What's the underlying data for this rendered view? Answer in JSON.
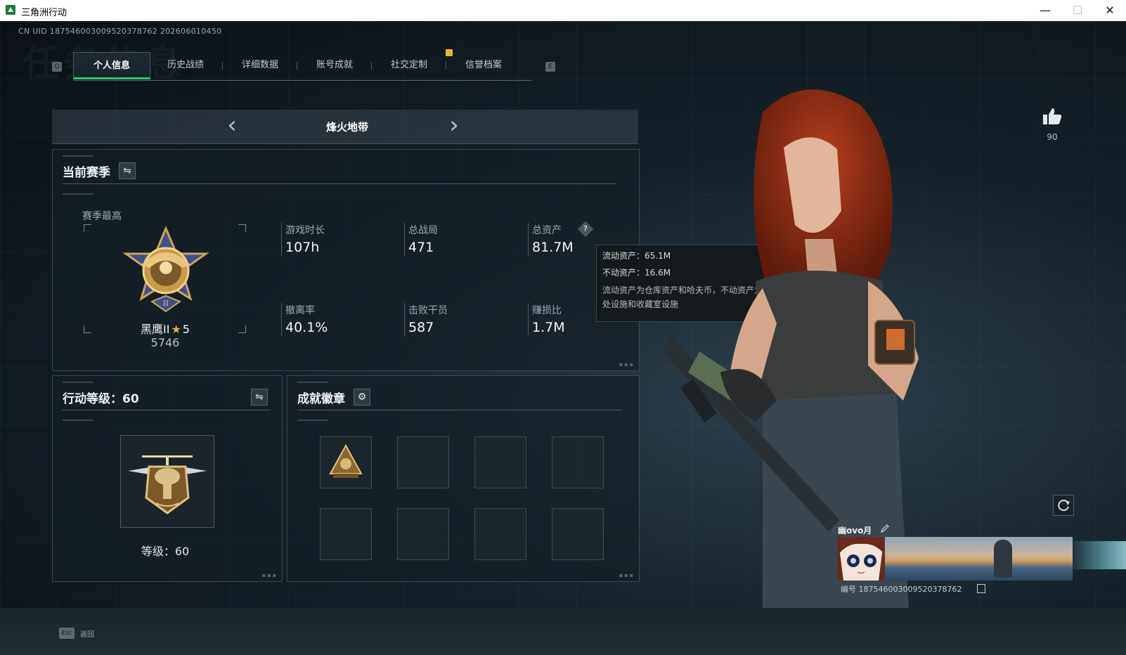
{
  "window": {
    "title": "三角洲行动",
    "minimize_glyph": "—",
    "maximize_glyph": "☐",
    "close_glyph": "✕"
  },
  "header": {
    "uid": "CN UID 1875460030095203787​62 202606010450",
    "watermark": "任务信息"
  },
  "tabs": {
    "prev_key": "Q",
    "next_key": "E",
    "items": [
      {
        "label": "个人信息",
        "active": true
      },
      {
        "label": "历史战绩",
        "active": false
      },
      {
        "label": "详细数据",
        "active": false
      },
      {
        "label": "账号成就",
        "active": false
      },
      {
        "label": "社交定制",
        "active": false,
        "alert": true
      },
      {
        "label": "信誉档案",
        "active": false
      }
    ]
  },
  "mode": {
    "title": "烽火地带",
    "prev_glyph": "‹",
    "next_glyph": "›"
  },
  "season": {
    "heading": "当前赛季",
    "best_label": "赛季最高",
    "rank_name": "黑鹰II",
    "rank_stars": "5",
    "rank_score": "5746",
    "stats": [
      {
        "label": "游戏时长",
        "value": "107h"
      },
      {
        "label": "总战局",
        "value": "471"
      },
      {
        "label": "总资产",
        "value": "81.7M"
      },
      {
        "label": "撤离率",
        "value": "40.1%"
      },
      {
        "label": "击败干员",
        "value": "587"
      },
      {
        "label": "赚损比",
        "value": "1.7M"
      }
    ]
  },
  "tooltip": {
    "liquid": "流动资产：65.1M",
    "fixed": "不动资产：16.6M",
    "desc": "流动资产为仓库资产和哈夫币，不动资产为特勤处设施和收藏室设施"
  },
  "level": {
    "heading": "行动等级：60",
    "level_text": "等级：60"
  },
  "badges": {
    "heading": "成就徽章",
    "slots": 8
  },
  "profile": {
    "likes": "90",
    "name": "幽ovo月",
    "id_text": "编号 18754600300952037876​2"
  },
  "footer": {
    "esc_key": "Esc",
    "esc_label": "返回"
  },
  "colors": {
    "accent_green": "#27c86a",
    "alert_yellow": "#e8b331",
    "gold": "#e3b44a"
  }
}
